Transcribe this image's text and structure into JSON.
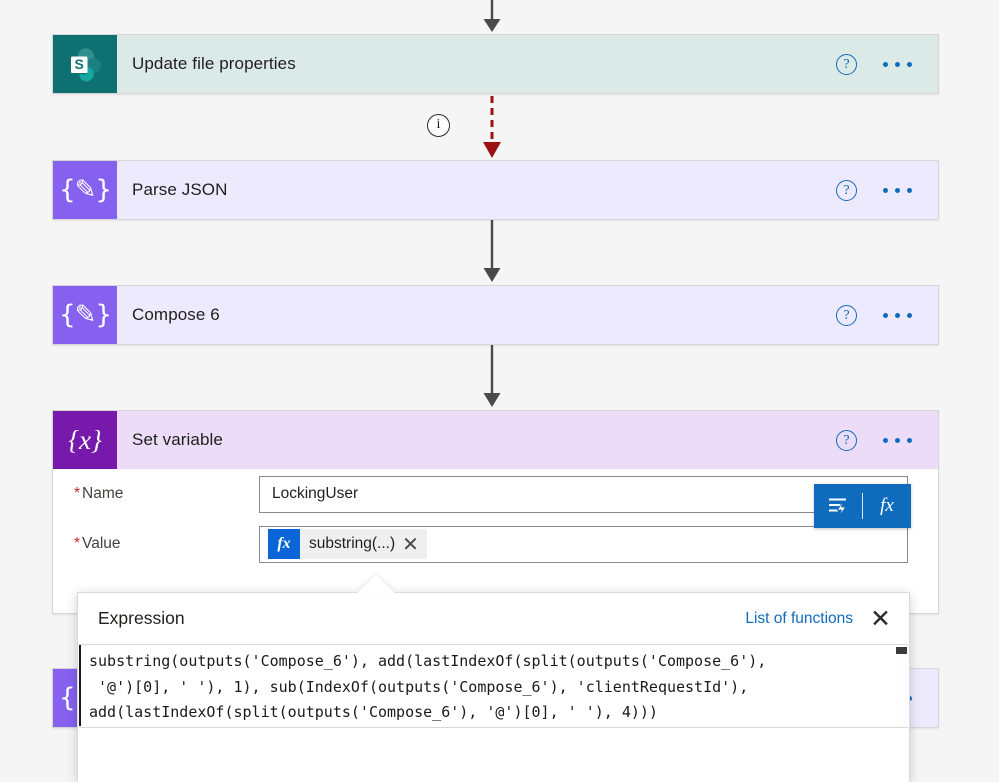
{
  "flow": {
    "cards": [
      {
        "id": "update-file-properties",
        "title": "Update file properties",
        "icon": "sharepoint-icon",
        "theme": "sharepoint",
        "help_label": "?",
        "menu_label": "..."
      },
      {
        "id": "parse-json",
        "title": "Parse JSON",
        "icon": "compose-braces-icon",
        "theme": "compose",
        "help_label": "?",
        "menu_label": "..."
      },
      {
        "id": "compose-6",
        "title": "Compose 6",
        "icon": "compose-braces-icon",
        "theme": "compose",
        "help_label": "?",
        "menu_label": "..."
      },
      {
        "id": "set-variable",
        "title": "Set variable",
        "icon": "variable-braces-icon",
        "theme": "setvar",
        "help_label": "?",
        "menu_label": "..."
      }
    ],
    "info_badge": "i",
    "connectors": [
      {
        "id": "connector-top",
        "style": "solid",
        "color": "#4a4a4a"
      },
      {
        "id": "connector-error",
        "style": "dashed",
        "color": "#9b1111"
      },
      {
        "id": "connector-parse-to-compose",
        "style": "solid",
        "color": "#4a4a4a"
      },
      {
        "id": "connector-compose-to-setvar",
        "style": "solid",
        "color": "#4a4a4a"
      }
    ]
  },
  "set_variable_form": {
    "name_field": {
      "label": "Name",
      "required_marker": "*",
      "value": "LockingUser"
    },
    "value_field": {
      "label": "Value",
      "required_marker": "*",
      "token_fx": "fx",
      "token_text": "substring(...)",
      "token_remove": "✕"
    },
    "toolbar": {
      "dynamic_content_label": "dynamic-content",
      "fx_label": "fx"
    }
  },
  "expression_panel": {
    "title": "Expression",
    "list_of_functions": "List of functions",
    "close_label": "✕",
    "expression": "substring(outputs('Compose_6'), add(lastIndexOf(split(outputs('Compose_6'),\n '@')[0], ' '), 1), sub(IndexOf(outputs('Compose_6'), 'clientRequestId'),\nadd(lastIndexOf(split(outputs('Compose_6'), '@')[0], ' '), 4)))"
  },
  "colors": {
    "sharepoint_icon": "#0e7070",
    "sharepoint_card": "#dbe9e7",
    "compose_icon": "#8661f0",
    "compose_card": "#eeeafd",
    "setvar_icon": "#7719aa",
    "setvar_card": "#ecdcf7",
    "accent_blue": "#0f6cbd",
    "error_red": "#9b1111",
    "required_red": "#cc2727"
  }
}
